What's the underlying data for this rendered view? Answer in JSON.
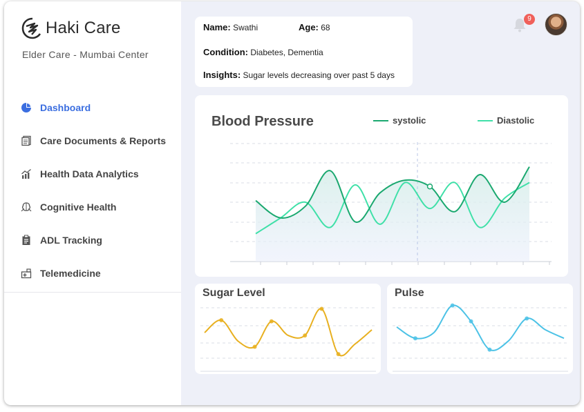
{
  "app": {
    "name": "Haki Care",
    "subtitle": "Elder Care - Mumbai Center"
  },
  "sidebar": {
    "items": [
      {
        "label": "Dashboard",
        "icon": "pie-chart-icon",
        "active": true
      },
      {
        "label": "Care Documents & Reports",
        "icon": "documents-icon",
        "active": false
      },
      {
        "label": "Health Data Analytics",
        "icon": "analytics-icon",
        "active": false
      },
      {
        "label": "Cognitive Health",
        "icon": "brain-icon",
        "active": false
      },
      {
        "label": "ADL Tracking",
        "icon": "clipboard-icon",
        "active": false
      },
      {
        "label": "Telemedicine",
        "icon": "medical-kit-icon",
        "active": false
      }
    ]
  },
  "patient": {
    "name_label": "Name:",
    "name": "Swathi",
    "age_label": "Age:",
    "age": "68",
    "condition_label": "Condition:",
    "condition": "Diabetes, Dementia",
    "insights_label": "Insights:",
    "insights": "Sugar levels decreasing over past 5 days"
  },
  "header": {
    "notification_count": "9"
  },
  "colors": {
    "accent": "#3b6ee0",
    "systolic": "#1aa86f",
    "diastolic": "#3fe0a8",
    "sugar": "#e8b020",
    "pulse": "#4cc2e6",
    "badge": "#f0605a"
  },
  "chart_data": [
    {
      "type": "line",
      "title": "Blood Pressure",
      "series": [
        {
          "name": "systolic",
          "values": [
            52,
            30,
            45,
            90,
            25,
            62,
            78,
            70,
            38,
            85,
            50,
            95
          ]
        },
        {
          "name": "Diastolic",
          "values": [
            10,
            30,
            50,
            18,
            72,
            22,
            75,
            42,
            75,
            18,
            55,
            75
          ]
        }
      ],
      "grid": true,
      "legend": "top-right"
    },
    {
      "type": "line",
      "title": "Sugar Level",
      "series": [
        {
          "name": "",
          "values": [
            50,
            72,
            35,
            25,
            70,
            45,
            45,
            92,
            12,
            30,
            55
          ]
        }
      ],
      "grid": true
    },
    {
      "type": "line",
      "title": "Pulse",
      "series": [
        {
          "name": "",
          "values": [
            60,
            40,
            50,
            98,
            70,
            20,
            35,
            75,
            55,
            40
          ]
        }
      ],
      "grid": true
    }
  ]
}
